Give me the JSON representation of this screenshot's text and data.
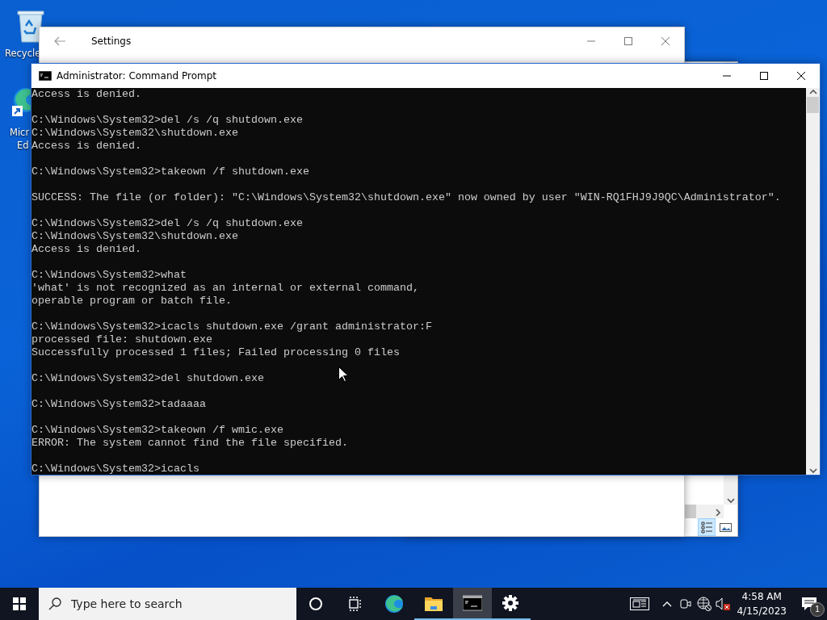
{
  "desktop_icons": [
    {
      "kind": "recycle-bin",
      "label_lines": [
        "Recycle"
      ]
    },
    {
      "kind": "browser-shortcut",
      "label_lines": [
        "Micr",
        "Ed"
      ]
    }
  ],
  "background_window": {
    "view_buttons": [
      {
        "kind": "details",
        "selected": true
      },
      {
        "kind": "large-icons",
        "selected": false
      }
    ]
  },
  "settings_window": {
    "title": "Settings"
  },
  "console_window": {
    "title": "Administrator: Command Prompt",
    "blocks": [
      [
        "Access is denied."
      ],
      [
        "C:\\Windows\\System32>del /s /q shutdown.exe",
        "C:\\Windows\\System32\\shutdown.exe",
        "Access is denied."
      ],
      [
        "C:\\Windows\\System32>takeown /f shutdown.exe"
      ],
      [
        "SUCCESS: The file (or folder): \"C:\\Windows\\System32\\shutdown.exe\" now owned by user \"WIN-RQ1FHJ9J9QC\\Administrator\"."
      ],
      [
        "C:\\Windows\\System32>del /s /q shutdown.exe",
        "C:\\Windows\\System32\\shutdown.exe",
        "Access is denied."
      ],
      [
        "C:\\Windows\\System32>what",
        "'what' is not recognized as an internal or external command,",
        "operable program or batch file."
      ],
      [
        "C:\\Windows\\System32>icacls shutdown.exe /grant administrator:F",
        "processed file: shutdown.exe",
        "Successfully processed 1 files; Failed processing 0 files"
      ],
      [
        "C:\\Windows\\System32>del shutdown.exe"
      ],
      [
        "C:\\Windows\\System32>tadaaaa"
      ],
      [
        "C:\\Windows\\System32>takeown /f wmic.exe",
        "ERROR: The system cannot find the file specified."
      ],
      [
        "C:\\Windows\\System32>icacls"
      ]
    ]
  },
  "taskbar": {
    "search": {
      "placeholder": "Type here to search"
    },
    "items": [
      {
        "kind": "cortana",
        "running": false,
        "selected": false
      },
      {
        "kind": "task-view",
        "running": false,
        "selected": false
      },
      {
        "kind": "browser",
        "running": false,
        "selected": false
      },
      {
        "kind": "folder",
        "running": true,
        "selected": false
      },
      {
        "kind": "terminal",
        "running": true,
        "selected": true
      },
      {
        "kind": "settings",
        "running": true,
        "selected": false
      }
    ],
    "tray": [
      {
        "kind": "news"
      },
      {
        "kind": "chevron"
      },
      {
        "kind": "meet"
      },
      {
        "kind": "network"
      },
      {
        "kind": "volume-muted"
      }
    ],
    "clock": {
      "time": "4:58 AM",
      "date": "4/15/2023"
    },
    "notifications": {
      "badge": "1"
    }
  }
}
